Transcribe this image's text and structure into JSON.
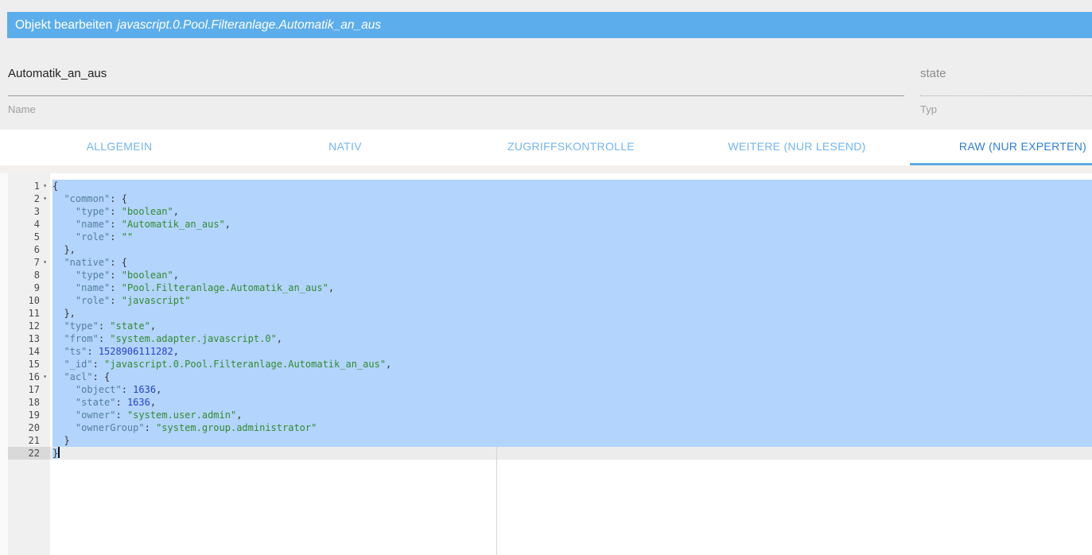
{
  "header": {
    "title": "Objekt bearbeiten",
    "object_id": "javascript.0.Pool.Filteranlage.Automatik_an_aus"
  },
  "form": {
    "name_value": "Automatik_an_aus",
    "name_label": "Name",
    "type_value": "state",
    "type_label": "Typ"
  },
  "tabs": [
    {
      "label": "ALLGEMEIN",
      "active": false
    },
    {
      "label": "NATIV",
      "active": false
    },
    {
      "label": "ZUGRIFFSKONTROLLE",
      "active": false
    },
    {
      "label": "WEITERE (NUR LESEND)",
      "active": false
    },
    {
      "label": "RAW (NUR EXPERTEN)",
      "active": true
    }
  ],
  "colors": {
    "header_bg": "#5cadeb",
    "tab_active": "#2d7ed3",
    "tab_inactive": "#74b6ef",
    "tab_indicator": "#5fa8e8",
    "selection": "#b3d4fc",
    "active_line": "#ececec",
    "json_key": "#54809f",
    "json_string": "#318c31",
    "json_number": "#2442cf"
  },
  "editor": {
    "active_line": 22,
    "selected_lines_from": 1,
    "selected_lines_to": 21,
    "fold_lines": [
      1,
      2,
      7,
      16
    ],
    "lines": [
      {
        "num": 1,
        "tokens": [
          [
            "p",
            "{"
          ]
        ]
      },
      {
        "num": 2,
        "tokens": [
          [
            "p",
            "  "
          ],
          [
            "k",
            "\"common\""
          ],
          [
            "p",
            ": {"
          ]
        ]
      },
      {
        "num": 3,
        "tokens": [
          [
            "p",
            "    "
          ],
          [
            "k",
            "\"type\""
          ],
          [
            "p",
            ": "
          ],
          [
            "s",
            "\"boolean\""
          ],
          [
            "p",
            ","
          ]
        ]
      },
      {
        "num": 4,
        "tokens": [
          [
            "p",
            "    "
          ],
          [
            "k",
            "\"name\""
          ],
          [
            "p",
            ": "
          ],
          [
            "s",
            "\"Automatik_an_aus\""
          ],
          [
            "p",
            ","
          ]
        ]
      },
      {
        "num": 5,
        "tokens": [
          [
            "p",
            "    "
          ],
          [
            "k",
            "\"role\""
          ],
          [
            "p",
            ": "
          ],
          [
            "s",
            "\"\""
          ]
        ]
      },
      {
        "num": 6,
        "tokens": [
          [
            "p",
            "  },"
          ]
        ]
      },
      {
        "num": 7,
        "tokens": [
          [
            "p",
            "  "
          ],
          [
            "k",
            "\"native\""
          ],
          [
            "p",
            ": {"
          ]
        ]
      },
      {
        "num": 8,
        "tokens": [
          [
            "p",
            "    "
          ],
          [
            "k",
            "\"type\""
          ],
          [
            "p",
            ": "
          ],
          [
            "s",
            "\"boolean\""
          ],
          [
            "p",
            ","
          ]
        ]
      },
      {
        "num": 9,
        "tokens": [
          [
            "p",
            "    "
          ],
          [
            "k",
            "\"name\""
          ],
          [
            "p",
            ": "
          ],
          [
            "s",
            "\"Pool.Filteranlage.Automatik_an_aus\""
          ],
          [
            "p",
            ","
          ]
        ]
      },
      {
        "num": 10,
        "tokens": [
          [
            "p",
            "    "
          ],
          [
            "k",
            "\"role\""
          ],
          [
            "p",
            ": "
          ],
          [
            "s",
            "\"javascript\""
          ]
        ]
      },
      {
        "num": 11,
        "tokens": [
          [
            "p",
            "  },"
          ]
        ]
      },
      {
        "num": 12,
        "tokens": [
          [
            "p",
            "  "
          ],
          [
            "k",
            "\"type\""
          ],
          [
            "p",
            ": "
          ],
          [
            "s",
            "\"state\""
          ],
          [
            "p",
            ","
          ]
        ]
      },
      {
        "num": 13,
        "tokens": [
          [
            "p",
            "  "
          ],
          [
            "k",
            "\"from\""
          ],
          [
            "p",
            ": "
          ],
          [
            "s",
            "\"system.adapter.javascript.0\""
          ],
          [
            "p",
            ","
          ]
        ]
      },
      {
        "num": 14,
        "tokens": [
          [
            "p",
            "  "
          ],
          [
            "k",
            "\"ts\""
          ],
          [
            "p",
            ": "
          ],
          [
            "n",
            "1528906111282"
          ],
          [
            "p",
            ","
          ]
        ]
      },
      {
        "num": 15,
        "tokens": [
          [
            "p",
            "  "
          ],
          [
            "k",
            "\"_id\""
          ],
          [
            "p",
            ": "
          ],
          [
            "s",
            "\"javascript.0.Pool.Filteranlage.Automatik_an_aus\""
          ],
          [
            "p",
            ","
          ]
        ]
      },
      {
        "num": 16,
        "tokens": [
          [
            "p",
            "  "
          ],
          [
            "k",
            "\"acl\""
          ],
          [
            "p",
            ": {"
          ]
        ]
      },
      {
        "num": 17,
        "tokens": [
          [
            "p",
            "    "
          ],
          [
            "k",
            "\"object\""
          ],
          [
            "p",
            ": "
          ],
          [
            "n",
            "1636"
          ],
          [
            "p",
            ","
          ]
        ]
      },
      {
        "num": 18,
        "tokens": [
          [
            "p",
            "    "
          ],
          [
            "k",
            "\"state\""
          ],
          [
            "p",
            ": "
          ],
          [
            "n",
            "1636"
          ],
          [
            "p",
            ","
          ]
        ]
      },
      {
        "num": 19,
        "tokens": [
          [
            "p",
            "    "
          ],
          [
            "k",
            "\"owner\""
          ],
          [
            "p",
            ": "
          ],
          [
            "s",
            "\"system.user.admin\""
          ],
          [
            "p",
            ","
          ]
        ]
      },
      {
        "num": 20,
        "tokens": [
          [
            "p",
            "    "
          ],
          [
            "k",
            "\"ownerGroup\""
          ],
          [
            "p",
            ": "
          ],
          [
            "s",
            "\"system.group.administrator\""
          ]
        ]
      },
      {
        "num": 21,
        "tokens": [
          [
            "p",
            "  }"
          ]
        ]
      },
      {
        "num": 22,
        "tokens": [
          [
            "p",
            "}"
          ]
        ]
      }
    ]
  }
}
